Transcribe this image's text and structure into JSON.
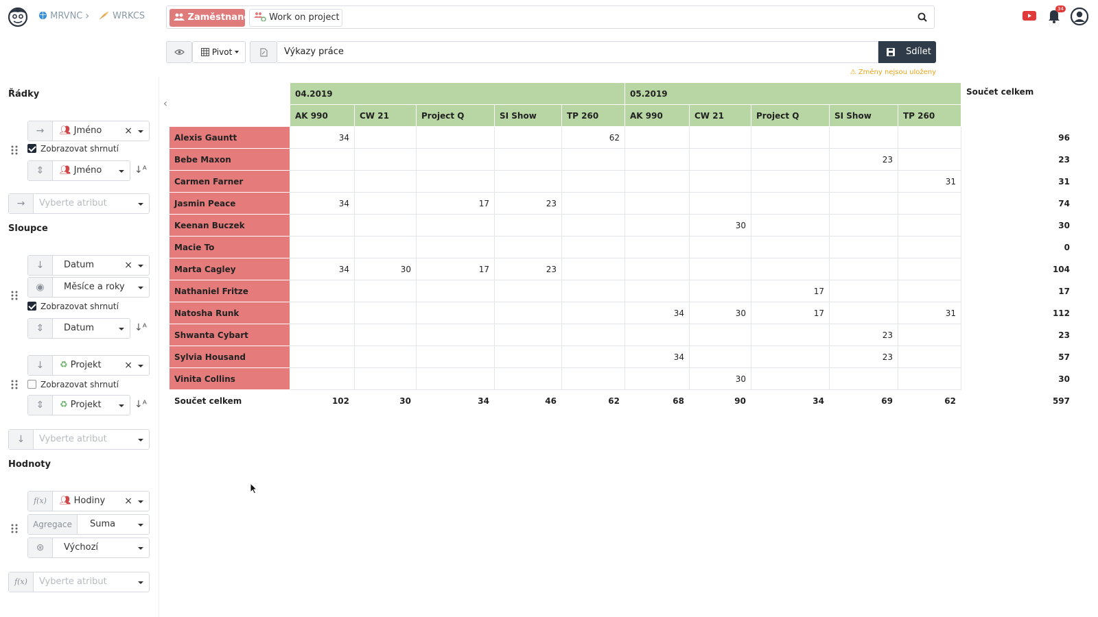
{
  "header": {
    "breadcrumb": [
      {
        "label": "MRVNC",
        "icon": "globe-icon"
      },
      {
        "label": "WRKCS",
        "icon": "feather-icon"
      }
    ],
    "search": {
      "chips": [
        {
          "label": "Zaměstnanci",
          "icon": "people-icon",
          "color": "#e07b7b"
        },
        {
          "label": "Work on project",
          "icon": "people-link-icon"
        }
      ]
    },
    "notifications_count": "34"
  },
  "toolbar": {
    "pivot_label": "Pivot",
    "query_label": "Výkazy práce",
    "share_label": "Sdílet",
    "unsaved_label": "Změny nejsou uloženy"
  },
  "sidebar": {
    "rows_title": "Řádky",
    "columns_title": "Sloupce",
    "values_title": "Hodnoty",
    "rows": {
      "attr": "Jméno",
      "show_summary": "Zobrazovat shrnutí",
      "sort_attr": "Jméno",
      "placeholder": "Vyberte atribut"
    },
    "columns": [
      {
        "attr": "Datum",
        "format": "Měsíce a roky",
        "show_summary": "Zobrazovat shrnutí",
        "sort_attr": "Datum",
        "checked": true
      },
      {
        "attr": "Projekt",
        "show_summary": "Zobrazovat shrnutí",
        "sort_attr": "Projekt",
        "checked": false
      }
    ],
    "columns_placeholder": "Vyberte atribut",
    "values": {
      "attr": "Hodiny",
      "aggregation_label": "Agregace",
      "aggregation": "Suma",
      "default": "Výchozí",
      "placeholder": "Vyberte atribut"
    }
  },
  "pivot": {
    "months": [
      "04.2019",
      "05.2019"
    ],
    "projects": [
      "AK 990",
      "CW 21",
      "Project Q",
      "SI Show",
      "TP 260"
    ],
    "grand_total_label": "Součet celkem",
    "rows": [
      {
        "name": "Alexis Gauntt",
        "values": [
          "34",
          "",
          "",
          "",
          "62",
          "",
          "",
          "",
          "",
          ""
        ],
        "total": "96"
      },
      {
        "name": "Bebe Maxon",
        "values": [
          "",
          "",
          "",
          "",
          "",
          "",
          "",
          "",
          "23",
          ""
        ],
        "total": "23"
      },
      {
        "name": "Carmen Farner",
        "values": [
          "",
          "",
          "",
          "",
          "",
          "",
          "",
          "",
          "",
          "31"
        ],
        "total": "31"
      },
      {
        "name": "Jasmin Peace",
        "values": [
          "34",
          "",
          "17",
          "23",
          "",
          "",
          "",
          "",
          "",
          ""
        ],
        "total": "74"
      },
      {
        "name": "Keenan Buczek",
        "values": [
          "",
          "",
          "",
          "",
          "",
          "",
          "30",
          "",
          "",
          ""
        ],
        "total": "30"
      },
      {
        "name": "Macie To",
        "values": [
          "",
          "",
          "",
          "",
          "",
          "",
          "",
          "",
          "",
          ""
        ],
        "total": "0"
      },
      {
        "name": "Marta Cagley",
        "values": [
          "34",
          "30",
          "17",
          "23",
          "",
          "",
          "",
          "",
          "",
          ""
        ],
        "total": "104"
      },
      {
        "name": "Nathaniel Fritze",
        "values": [
          "",
          "",
          "",
          "",
          "",
          "",
          "",
          "17",
          "",
          ""
        ],
        "total": "17"
      },
      {
        "name": "Natosha Runk",
        "values": [
          "",
          "",
          "",
          "",
          "",
          "34",
          "30",
          "17",
          "",
          "31"
        ],
        "total": "112"
      },
      {
        "name": "Shwanta Cybart",
        "values": [
          "",
          "",
          "",
          "",
          "",
          "",
          "",
          "",
          "23",
          ""
        ],
        "total": "23"
      },
      {
        "name": "Sylvia Housand",
        "values": [
          "",
          "",
          "",
          "",
          "",
          "34",
          "",
          "",
          "23",
          ""
        ],
        "total": "57"
      },
      {
        "name": "Vinita Collins",
        "values": [
          "",
          "",
          "",
          "",
          "",
          "",
          "30",
          "",
          "",
          ""
        ],
        "total": "30"
      }
    ],
    "footer": [
      "102",
      "30",
      "34",
      "46",
      "62",
      "68",
      "90",
      "34",
      "69",
      "62"
    ],
    "footer_total": "597"
  }
}
